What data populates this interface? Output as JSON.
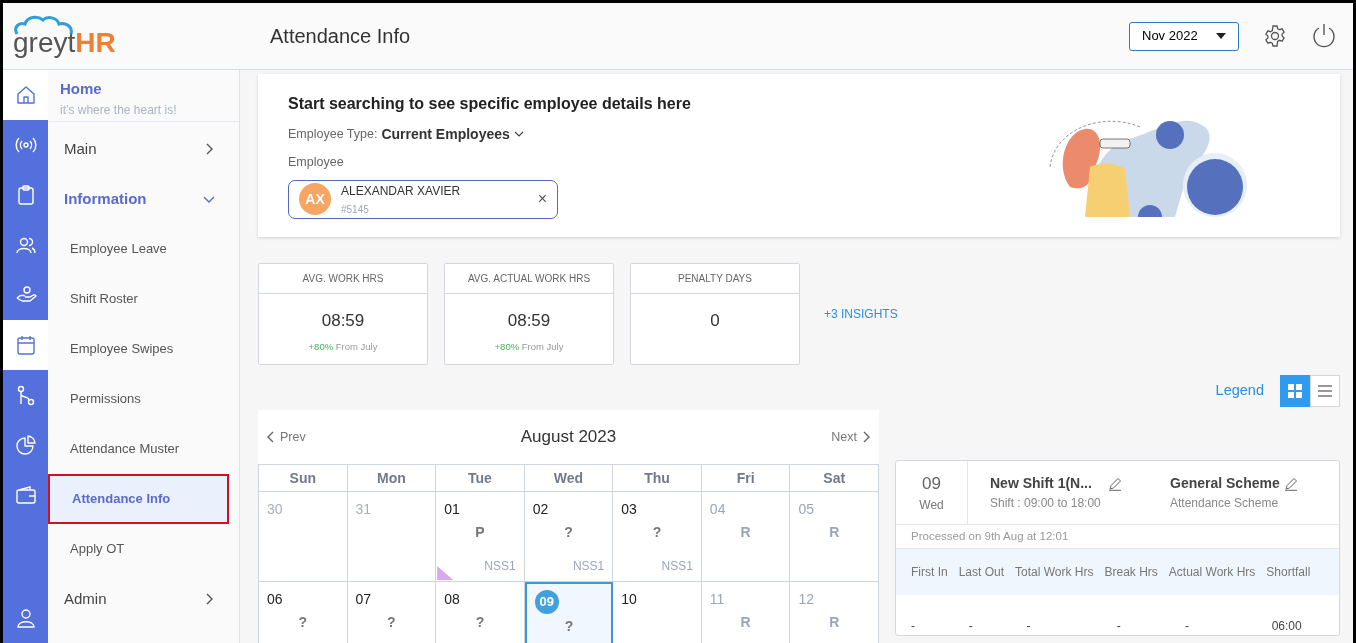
{
  "logo": {
    "part_1": "greyt",
    "part_2": "HR"
  },
  "header": {
    "title": "Attendance Info",
    "period": "Nov 2022"
  },
  "rail": [
    {
      "kind": "home",
      "selected": true
    },
    {
      "kind": "broadcast",
      "selected": false
    },
    {
      "kind": "clipboard",
      "selected": false
    },
    {
      "kind": "users",
      "selected": false
    },
    {
      "kind": "hand",
      "selected": false
    },
    {
      "kind": "calendar",
      "selected": true
    },
    {
      "kind": "branch",
      "selected": false
    },
    {
      "kind": "pie",
      "selected": false
    },
    {
      "kind": "wallet",
      "selected": false
    },
    {
      "kind": "user",
      "selected": false
    }
  ],
  "nav": {
    "home": {
      "title": "Home",
      "subtitle": "it’s where the heart is!"
    },
    "items": [
      {
        "label": "Main",
        "expanded": false
      },
      {
        "label": "Information",
        "expanded": true,
        "children": [
          {
            "label": "Employee Leave",
            "selected": false
          },
          {
            "label": "Shift Roster",
            "selected": false
          },
          {
            "label": "Employee Swipes",
            "selected": false
          },
          {
            "label": "Permissions",
            "selected": false
          },
          {
            "label": "Attendance Muster",
            "selected": false
          },
          {
            "label": "Attendance Info",
            "selected": true
          },
          {
            "label": "Apply OT",
            "selected": false
          }
        ]
      },
      {
        "label": "Admin",
        "expanded": false
      }
    ]
  },
  "search": {
    "heading": "Start searching to see specific employee details here",
    "type_label": "Employee Type:",
    "type_value": "Current Employees",
    "employee_label": "Employee",
    "employee": {
      "initials": "AX",
      "name": "ALEXANDAR XAVIER",
      "id": "#5145",
      "clear": "×"
    }
  },
  "insights": [
    {
      "title": "AVG. WORK HRS",
      "value": "08:59",
      "change": "+80%",
      "period": "From July"
    },
    {
      "title": "AVG. ACTUAL WORK HRS",
      "value": "08:59",
      "change": "+80%",
      "period": "From July"
    },
    {
      "title": "PENALTY DAYS",
      "value": "0"
    }
  ],
  "more_insights": "+3 INSIGHTS",
  "view": {
    "legend": "Legend",
    "modes": [
      {
        "kind": "grid",
        "selected": true
      },
      {
        "kind": "list",
        "selected": false
      }
    ]
  },
  "calendar": {
    "prev": "Prev",
    "title": "August 2023",
    "next": "Next",
    "weekdays": [
      "Sun",
      "Mon",
      "Tue",
      "Wed",
      "Thu",
      "Fri",
      "Sat"
    ],
    "weeks": [
      [
        {
          "date": "30",
          "kind": "other_month",
          "selected": false
        },
        {
          "date": "31",
          "kind": "other_month",
          "selected": false
        },
        {
          "date": "01",
          "kind": "workday",
          "status": "P",
          "shift": "NSS1",
          "flagged": true,
          "selected": false
        },
        {
          "date": "02",
          "kind": "workday",
          "status": "?",
          "shift": "NSS1",
          "selected": false
        },
        {
          "date": "03",
          "kind": "workday",
          "status": "?",
          "shift": "NSS1",
          "selected": false
        },
        {
          "date": "04",
          "kind": "weekend",
          "status": "R",
          "selected": false
        },
        {
          "date": "05",
          "kind": "weekend",
          "status": "R",
          "selected": false
        }
      ],
      [
        {
          "date": "06",
          "kind": "workday",
          "status": "?",
          "selected": false
        },
        {
          "date": "07",
          "kind": "workday",
          "status": "?",
          "selected": false
        },
        {
          "date": "08",
          "kind": "workday",
          "status": "?",
          "selected": false
        },
        {
          "date": "09",
          "kind": "workday",
          "status": "?",
          "selected": true
        },
        {
          "date": "10",
          "kind": "workday",
          "selected": false
        },
        {
          "date": "11",
          "kind": "weekend",
          "status": "R",
          "selected": false
        },
        {
          "date": "12",
          "kind": "weekend",
          "status": "R",
          "selected": false
        }
      ]
    ]
  },
  "day_detail": {
    "date": "09",
    "weekday": "Wed",
    "shift_name": "New Shift 1(N...",
    "shift_time": "Shift : 09:00 to 18:00",
    "scheme_name": "General Scheme",
    "scheme_label": "Attendance Scheme",
    "processed": "Processed on 9th Aug at 12:01",
    "columns": [
      "First In",
      "Last Out",
      "Total Work Hrs",
      "Break Hrs",
      "Actual Work Hrs",
      "Shortfall"
    ],
    "row": [
      "-",
      "-",
      "-",
      "-",
      "-",
      "06:00"
    ]
  }
}
